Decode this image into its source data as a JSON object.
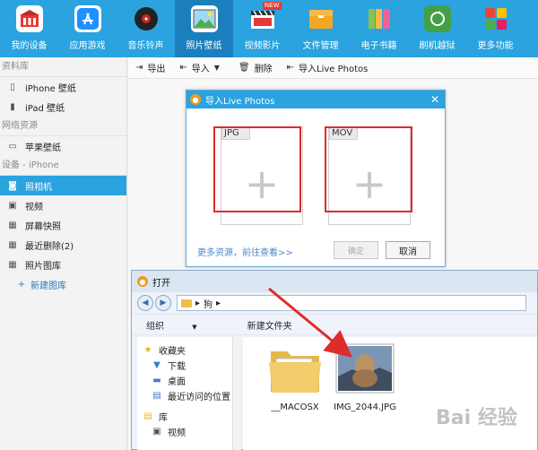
{
  "toolbar": [
    {
      "label": "我的设备",
      "icon": "my-device-icon",
      "color": "#2aa3df"
    },
    {
      "label": "应用游戏",
      "icon": "app-store-icon",
      "color": "#1e90ff"
    },
    {
      "label": "音乐铃声",
      "icon": "music-disc-icon",
      "color": "#222222"
    },
    {
      "label": "照片壁纸",
      "icon": "photo-icon",
      "color": "#4caf50"
    },
    {
      "label": "视频影片",
      "icon": "video-film-icon",
      "color": "#e53935"
    },
    {
      "label": "文件管理",
      "icon": "file-manager-icon",
      "color": "#f5a623"
    },
    {
      "label": "电子书籍",
      "icon": "ebook-icon",
      "color": "#f06292"
    },
    {
      "label": "刷机越狱",
      "icon": "flash-jailbreak-icon",
      "color": "#43a047"
    },
    {
      "label": "更多功能",
      "icon": "more-features-icon",
      "color": "#f44336"
    }
  ],
  "toolbar_new_badge": "NEW",
  "toolbar_active_index": 3,
  "sidebar": {
    "sections": [
      {
        "title": "资料库",
        "items": [
          {
            "label": "iPhone 壁纸",
            "icon": "phone-icon"
          },
          {
            "label": "iPad 壁纸",
            "icon": "tablet-icon"
          }
        ]
      },
      {
        "title": "网络资源",
        "items": [
          {
            "label": "苹果壁纸",
            "icon": "wallpaper-icon"
          }
        ]
      },
      {
        "title": "设备 - iPhone",
        "items": [
          {
            "label": "照相机",
            "icon": "camera-icon",
            "active": true
          },
          {
            "label": "视频",
            "icon": "video-icon"
          },
          {
            "label": "屏幕快照",
            "icon": "screenshot-icon"
          },
          {
            "label": "最近删除(2)",
            "icon": "recently-deleted-icon"
          },
          {
            "label": "照片图库",
            "icon": "photo-library-icon"
          }
        ]
      }
    ],
    "add_album": "新建图库"
  },
  "actions": {
    "export": "导出",
    "import": "导入",
    "delete": "删除",
    "import_live": "导入Live Photos"
  },
  "import_dialog": {
    "title": "导入Live Photos",
    "jpg_label": "JPG",
    "mov_label": "MOV",
    "more_link": "更多资源，前往查看>>",
    "confirm": "确定",
    "cancel": "取消"
  },
  "open_dialog": {
    "title": "打开",
    "path": "狗",
    "new_folder": "新建文件夹",
    "organize": "组织",
    "nav": {
      "favorites": "收藏夹",
      "downloads": "下载",
      "desktop": "桌面",
      "recent": "最近访问的位置",
      "libraries": "库",
      "videos": "视频"
    },
    "files": [
      {
        "name": "__MACOSX",
        "type": "folder"
      },
      {
        "name": "IMG_2044.JPG",
        "type": "image"
      }
    ]
  },
  "watermark": "Bai 经验"
}
